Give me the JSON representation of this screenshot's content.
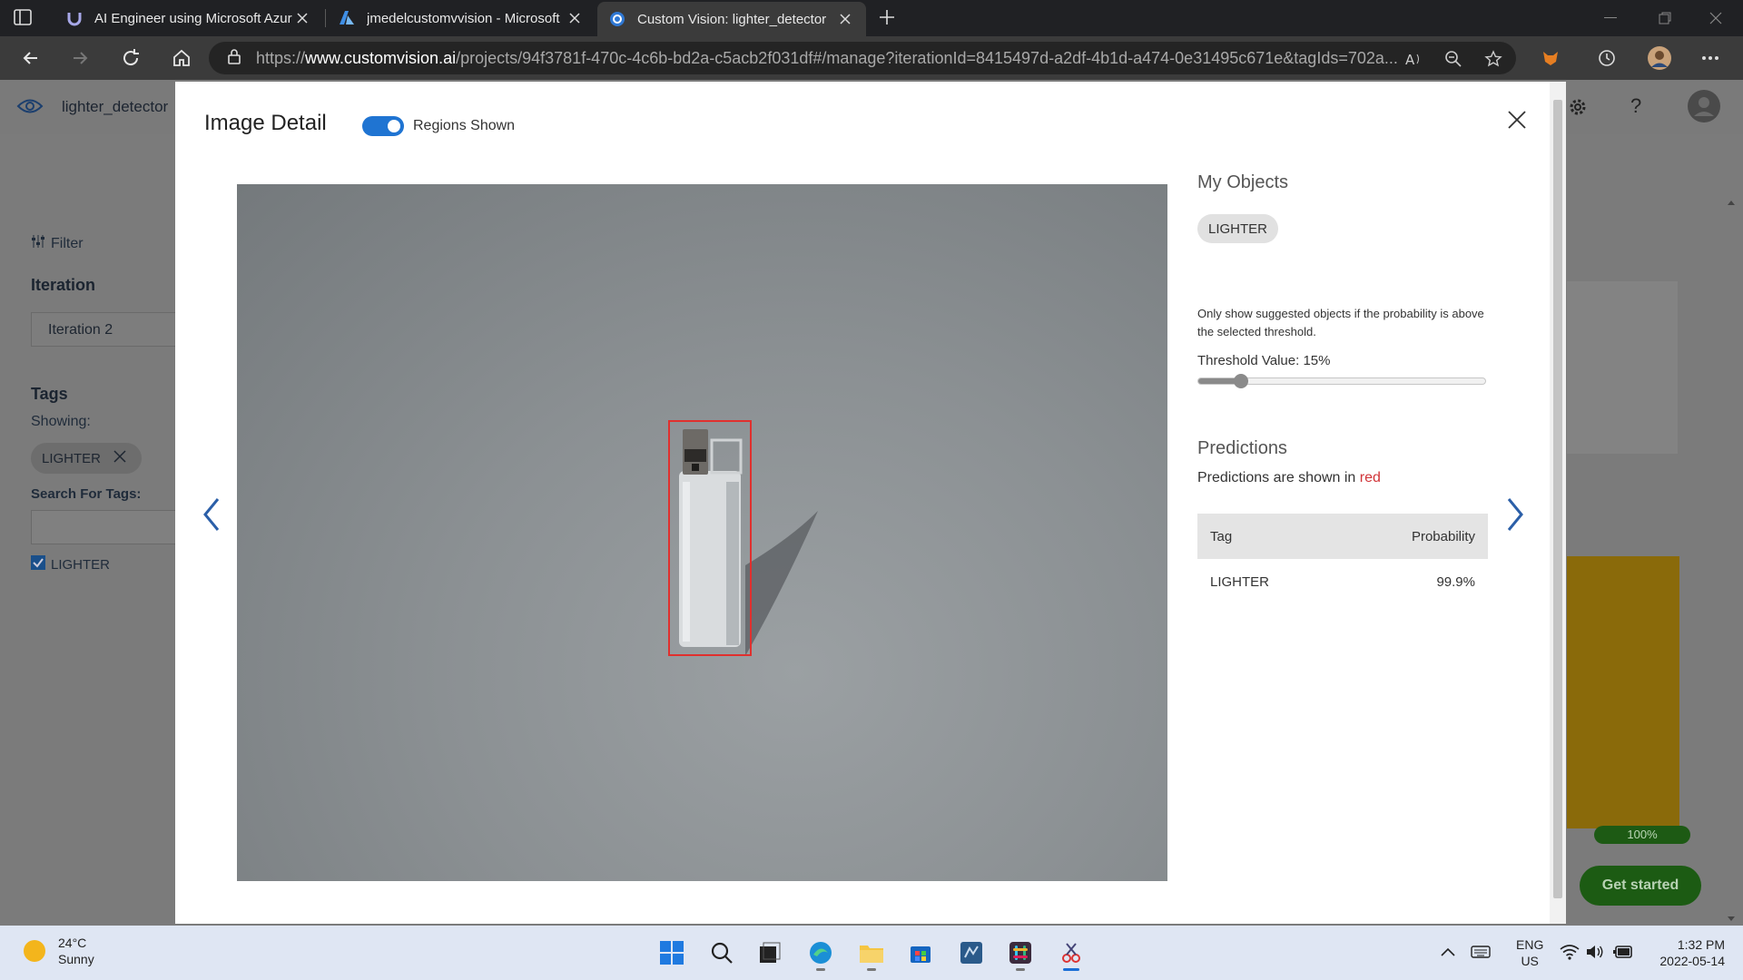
{
  "browser": {
    "tabs": [
      {
        "title": "AI Engineer using Microsoft Azur",
        "icon": "udemy-icon"
      },
      {
        "title": "jmedelcustomvvision - Microsoft",
        "icon": "azure-icon"
      },
      {
        "title": "Custom Vision: lighter_detector",
        "icon": "customvision-icon"
      }
    ],
    "url_prefix": "https://",
    "url_host": "www.customvision.ai",
    "url_path": "/projects/94f3781f-470c-4c6b-bd2a-c5acb2f031df#/manage?iterationId=8415497d-a2df-4b1d-a474-0e31495c671e&tagIds=702a..."
  },
  "app": {
    "project_name": "lighter_detector",
    "filter_label": "Filter",
    "iteration_heading": "Iteration",
    "iteration_value": "Iteration 2",
    "tags_heading": "Tags",
    "showing_label": "Showing:",
    "showing_tag": "LIGHTER",
    "search_tags_label": "Search For Tags:",
    "tag_checkbox_label": "LIGHTER",
    "tag_checked": true,
    "training_progress": "100%",
    "get_started": "Get started"
  },
  "modal": {
    "title": "Image Detail",
    "toggle_label": "Regions Shown",
    "toggle_on": true,
    "my_objects_title": "My Objects",
    "object_tag": "LIGHTER",
    "threshold_description": "Only show suggested objects if the probability is above the selected threshold.",
    "threshold_label": "Threshold Value: 15%",
    "threshold_value": 15,
    "predictions_title": "Predictions",
    "predictions_note_prefix": "Predictions are shown in",
    "predictions_note_color_word": "red",
    "table": {
      "headers": [
        "Tag",
        "Probability"
      ],
      "rows": [
        {
          "tag": "LIGHTER",
          "probability": "99.9%"
        }
      ]
    }
  },
  "taskbar": {
    "weather_temp": "24°C",
    "weather_desc": "Sunny",
    "apps": [
      "windows-start-icon",
      "search-icon",
      "task-view-icon",
      "edge-icon",
      "file-explorer-icon",
      "store-icon",
      "vscode-icon",
      "slack-icon",
      "snipping-tool-icon"
    ],
    "lang_line1": "ENG",
    "lang_line2": "US",
    "time": "1:32 PM",
    "date": "2022-05-14"
  },
  "colors": {
    "accent": "#1f74d2",
    "prediction_red": "#d13438",
    "chrome_dark": "#202124"
  }
}
